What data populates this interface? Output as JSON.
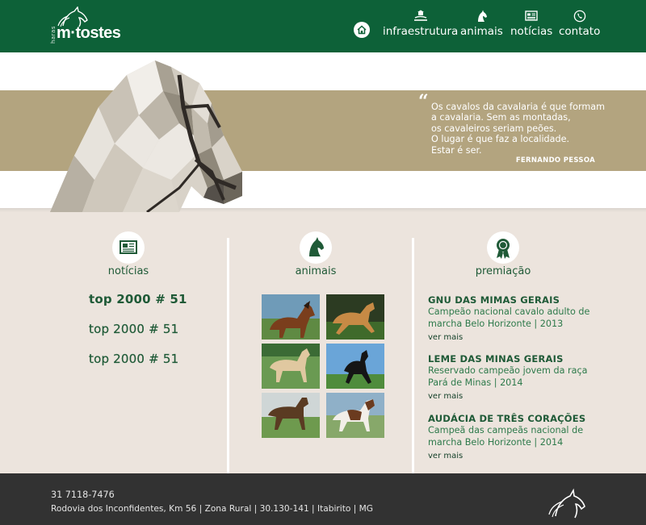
{
  "brand": {
    "small": "haras",
    "name": "m·tostes"
  },
  "nav": {
    "home_icon": "home-icon",
    "items": [
      {
        "label": "infraestrutura",
        "icon": "farm-icon"
      },
      {
        "label": "animais",
        "icon": "horse-head-icon"
      },
      {
        "label": "notícias",
        "icon": "newspaper-icon"
      },
      {
        "label": "contato",
        "icon": "phone-icon"
      }
    ]
  },
  "hero": {
    "quote_lines": [
      "Os cavalos da cavalaria é que formam",
      "a cavalaria. Sem as montadas,",
      "os cavaleiros seriam peões.",
      "O lugar é que faz a localidade.",
      "Estar é ser."
    ],
    "author": "FERNANDO PESSOA"
  },
  "columns": {
    "news": {
      "title": "notícias",
      "items": [
        "top 2000 # 51",
        "top 2000 # 51",
        "top 2000 # 51"
      ]
    },
    "animals": {
      "title": "animais"
    },
    "awards": {
      "title": "premiação",
      "items": [
        {
          "title": "GNU DAS MIMAS GERAIS",
          "desc": "Campeão nacional cavalo adulto de marcha Belo Horizonte | 2013",
          "more": "ver mais"
        },
        {
          "title": "LEME DAS MINAS GERAIS",
          "desc": "Reservado campeão jovem da raça Pará de Minas | 2014",
          "more": "ver mais"
        },
        {
          "title": "AUDÁCIA DE TRÊS CORAÇÕES",
          "desc": "Campeã das campeãs nacional de marcha Belo Horizonte | 2014",
          "more": "ver mais"
        }
      ]
    }
  },
  "footer": {
    "phone": "31 7118-7476",
    "address": "Rodovia dos Inconfidentes, Km 56  |  Zona Rural  |  30.130-141  | Itabirito | MG"
  },
  "colors": {
    "header_green": "#0d6138",
    "band_tan": "#b3a47f",
    "body_beige": "#ece4dd",
    "footer_gray": "#323232"
  }
}
